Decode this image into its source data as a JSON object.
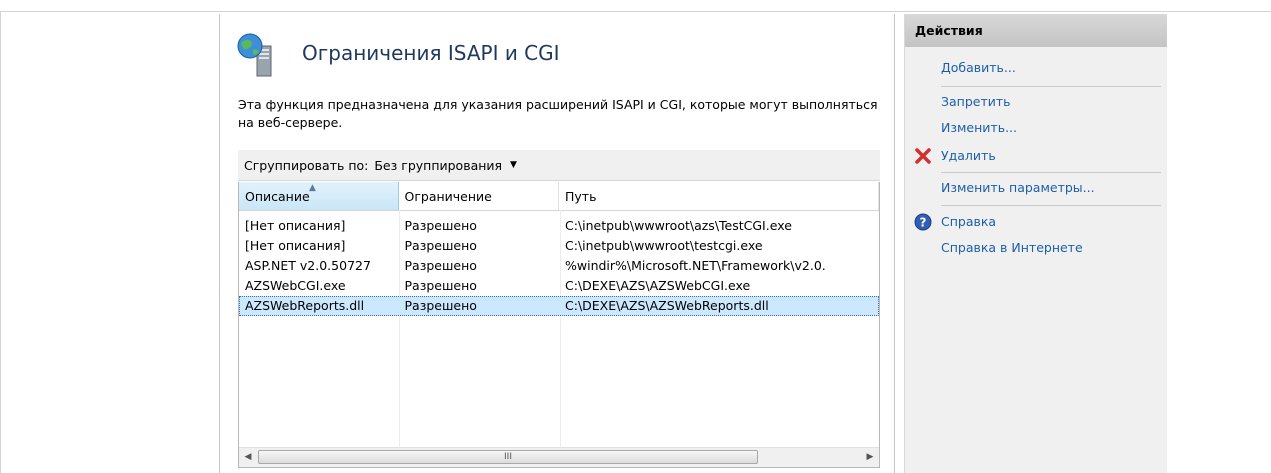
{
  "page": {
    "title": "Ограничения ISAPI и CGI",
    "description": "Эта функция предназначена для указания расширений ISAPI и CGI, которые могут выполняться на веб-сервере."
  },
  "grouping": {
    "label": "Сгруппировать по:",
    "value": "Без группирования"
  },
  "table": {
    "columns": [
      "Описание",
      "Ограничение",
      "Путь"
    ],
    "rows": [
      [
        "[Нет описания]",
        "Разрешено",
        "C:\\inetpub\\wwwroot\\azs\\TestCGI.exe"
      ],
      [
        "[Нет описания]",
        "Разрешено",
        "C:\\inetpub\\wwwroot\\testcgi.exe"
      ],
      [
        "ASP.NET v2.0.50727",
        "Разрешено",
        "%windir%\\Microsoft.NET\\Framework\\v2.0."
      ],
      [
        "AZSWebCGI.exe",
        "Разрешено",
        "C:\\DEXE\\AZS\\AZSWebCGI.exe"
      ],
      [
        "AZSWebReports.dll",
        "Разрешено",
        "C:\\DEXE\\AZS\\AZSWebReports.dll"
      ]
    ],
    "selected_index": 4,
    "scroll_grip": "III"
  },
  "actions": {
    "header": "Действия",
    "add": "Добавить...",
    "deny": "Запретить",
    "edit": "Изменить...",
    "delete": "Удалить",
    "edit_settings": "Изменить параметры...",
    "help": "Справка",
    "online_help": "Справка в Интернете"
  },
  "icons": {
    "feature": "globe-server-icon",
    "delete": "red-x-icon",
    "help": "blue-question-icon"
  },
  "colors": {
    "link": "#1c5fa8",
    "title": "#1e395b",
    "selected_row": "#cce8ff",
    "delete_x": "#d32f2f",
    "help_circle": "#2f5fb3"
  }
}
